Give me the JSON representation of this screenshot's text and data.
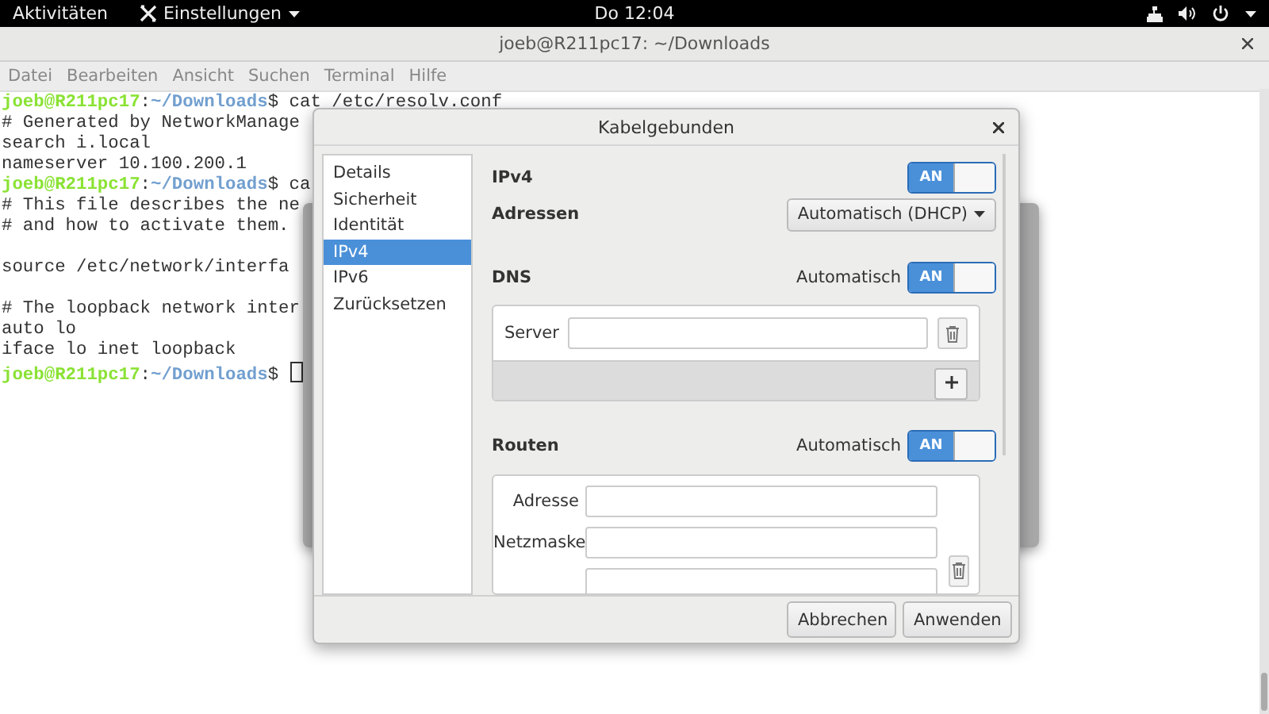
{
  "topbar": {
    "activities": "Aktivitäten",
    "app_menu": "Einstellungen",
    "clock": "Do 12:04"
  },
  "terminal": {
    "title": "joeb@R211pc17: ~/Downloads",
    "menu": [
      "Datei",
      "Bearbeiten",
      "Ansicht",
      "Suchen",
      "Terminal",
      "Hilfe"
    ],
    "lines": [
      {
        "kind": "prompt",
        "host": "joeb@R211pc17",
        "sep": ":",
        "path": "~/Downloads",
        "sign": "$",
        "command": " cat /etc/resolv.conf"
      },
      {
        "kind": "text",
        "text": "# Generated by NetworkManage"
      },
      {
        "kind": "text",
        "text": "search i.local"
      },
      {
        "kind": "text",
        "text": "nameserver 10.100.200.1"
      },
      {
        "kind": "prompt",
        "host": "joeb@R211pc17",
        "sep": ":",
        "path": "~/Downloads",
        "sign": "$",
        "command": " ca"
      },
      {
        "kind": "text",
        "text": "# This file describes the ne"
      },
      {
        "kind": "text",
        "text": "# and how to activate them."
      },
      {
        "kind": "blank"
      },
      {
        "kind": "text",
        "text": "source /etc/network/interfa"
      },
      {
        "kind": "blank"
      },
      {
        "kind": "text",
        "text": "# The loopback network inter"
      },
      {
        "kind": "text",
        "text": "auto lo"
      },
      {
        "kind": "text",
        "text": "iface lo inet loopback"
      },
      {
        "kind": "prompt",
        "host": "joeb@R211pc17",
        "sep": ":",
        "path": "~/Downloads",
        "sign": "$",
        "cursor": true
      }
    ]
  },
  "dialog": {
    "title": "Kabelgebunden",
    "sidebar": [
      {
        "label": "Details",
        "selected": false
      },
      {
        "label": "Sicherheit",
        "selected": false
      },
      {
        "label": "Identität",
        "selected": false
      },
      {
        "label": "IPv4",
        "selected": true
      },
      {
        "label": "IPv6",
        "selected": false
      },
      {
        "label": "Zurücksetzen",
        "selected": false
      }
    ],
    "ipv4": {
      "label": "IPv4",
      "switch": {
        "on": true,
        "text": "AN"
      }
    },
    "addresses": {
      "label": "Adressen",
      "method": "Automatisch (DHCP)"
    },
    "dns": {
      "label": "DNS",
      "auto_label": "Automatisch",
      "switch": {
        "on": true,
        "text": "AN"
      },
      "server_label": "Server"
    },
    "routes": {
      "label": "Routen",
      "auto_label": "Automatisch",
      "switch": {
        "on": true,
        "text": "AN"
      },
      "fields": [
        "Adresse",
        "Netzmaske"
      ]
    },
    "buttons": [
      "Abbrechen",
      "Anwenden"
    ]
  }
}
